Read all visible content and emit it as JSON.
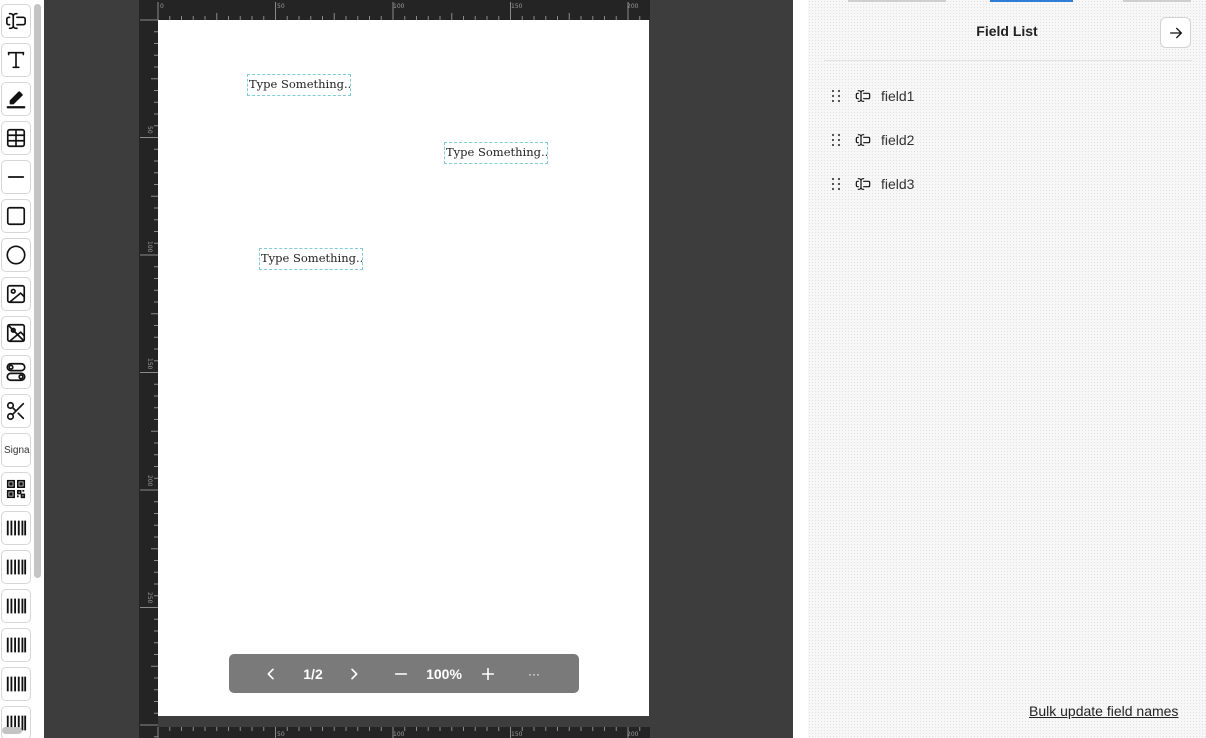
{
  "toolbar": {
    "tools": [
      {
        "name": "text-field-tool",
        "icon": "text-cursor-input-icon"
      },
      {
        "name": "text-tool",
        "icon": "text-icon"
      },
      {
        "name": "line-pen-tool",
        "icon": "pen-icon"
      },
      {
        "name": "table-tool",
        "icon": "table-icon"
      },
      {
        "name": "line-tool",
        "icon": "minus-icon"
      },
      {
        "name": "rectangle-tool",
        "icon": "square-icon"
      },
      {
        "name": "ellipse-tool",
        "icon": "circle-icon"
      },
      {
        "name": "image-tool",
        "icon": "image-icon"
      },
      {
        "name": "svg-tool",
        "icon": "image-off-icon"
      },
      {
        "name": "select-tool",
        "icon": "toggles-icon"
      },
      {
        "name": "checkbox-tool",
        "icon": "pen-off-icon"
      },
      {
        "name": "signature-tool",
        "label": "Signa"
      },
      {
        "name": "qrcode-tool",
        "icon": "qrcode-icon"
      },
      {
        "name": "barcode-tool-1",
        "icon": "barcode-icon"
      },
      {
        "name": "barcode-tool-2",
        "icon": "barcode-icon"
      },
      {
        "name": "barcode-tool-3",
        "icon": "barcode-icon"
      },
      {
        "name": "barcode-tool-4",
        "icon": "barcode-icon"
      },
      {
        "name": "barcode-tool-5",
        "icon": "barcode-icon"
      },
      {
        "name": "barcode-tool-6",
        "icon": "barcode-icon"
      }
    ]
  },
  "rulers": {
    "top_labels": [
      "0",
      "50",
      "100",
      "150",
      "200"
    ],
    "left_labels": [
      "50",
      "100",
      "150",
      "200",
      "250"
    ]
  },
  "page": {
    "fields": [
      {
        "name": "field1",
        "placeholder": "Type Something..."
      },
      {
        "name": "field2",
        "placeholder": "Type Something..."
      },
      {
        "name": "field3",
        "placeholder": "Type Something..."
      }
    ]
  },
  "pager": {
    "page_indicator": "1/2",
    "zoom_level": "100%",
    "more_label": "···"
  },
  "panel": {
    "title": "Field List",
    "fields": [
      {
        "label": "field1"
      },
      {
        "label": "field2"
      },
      {
        "label": "field3"
      }
    ],
    "bulk_update_label": "Bulk update field names"
  },
  "colors": {
    "canvas_bg": "#3d3d3d",
    "ruler_bg": "#242424",
    "field_border": "#7fcbd6",
    "pager_bg": "#7a7a7a"
  }
}
